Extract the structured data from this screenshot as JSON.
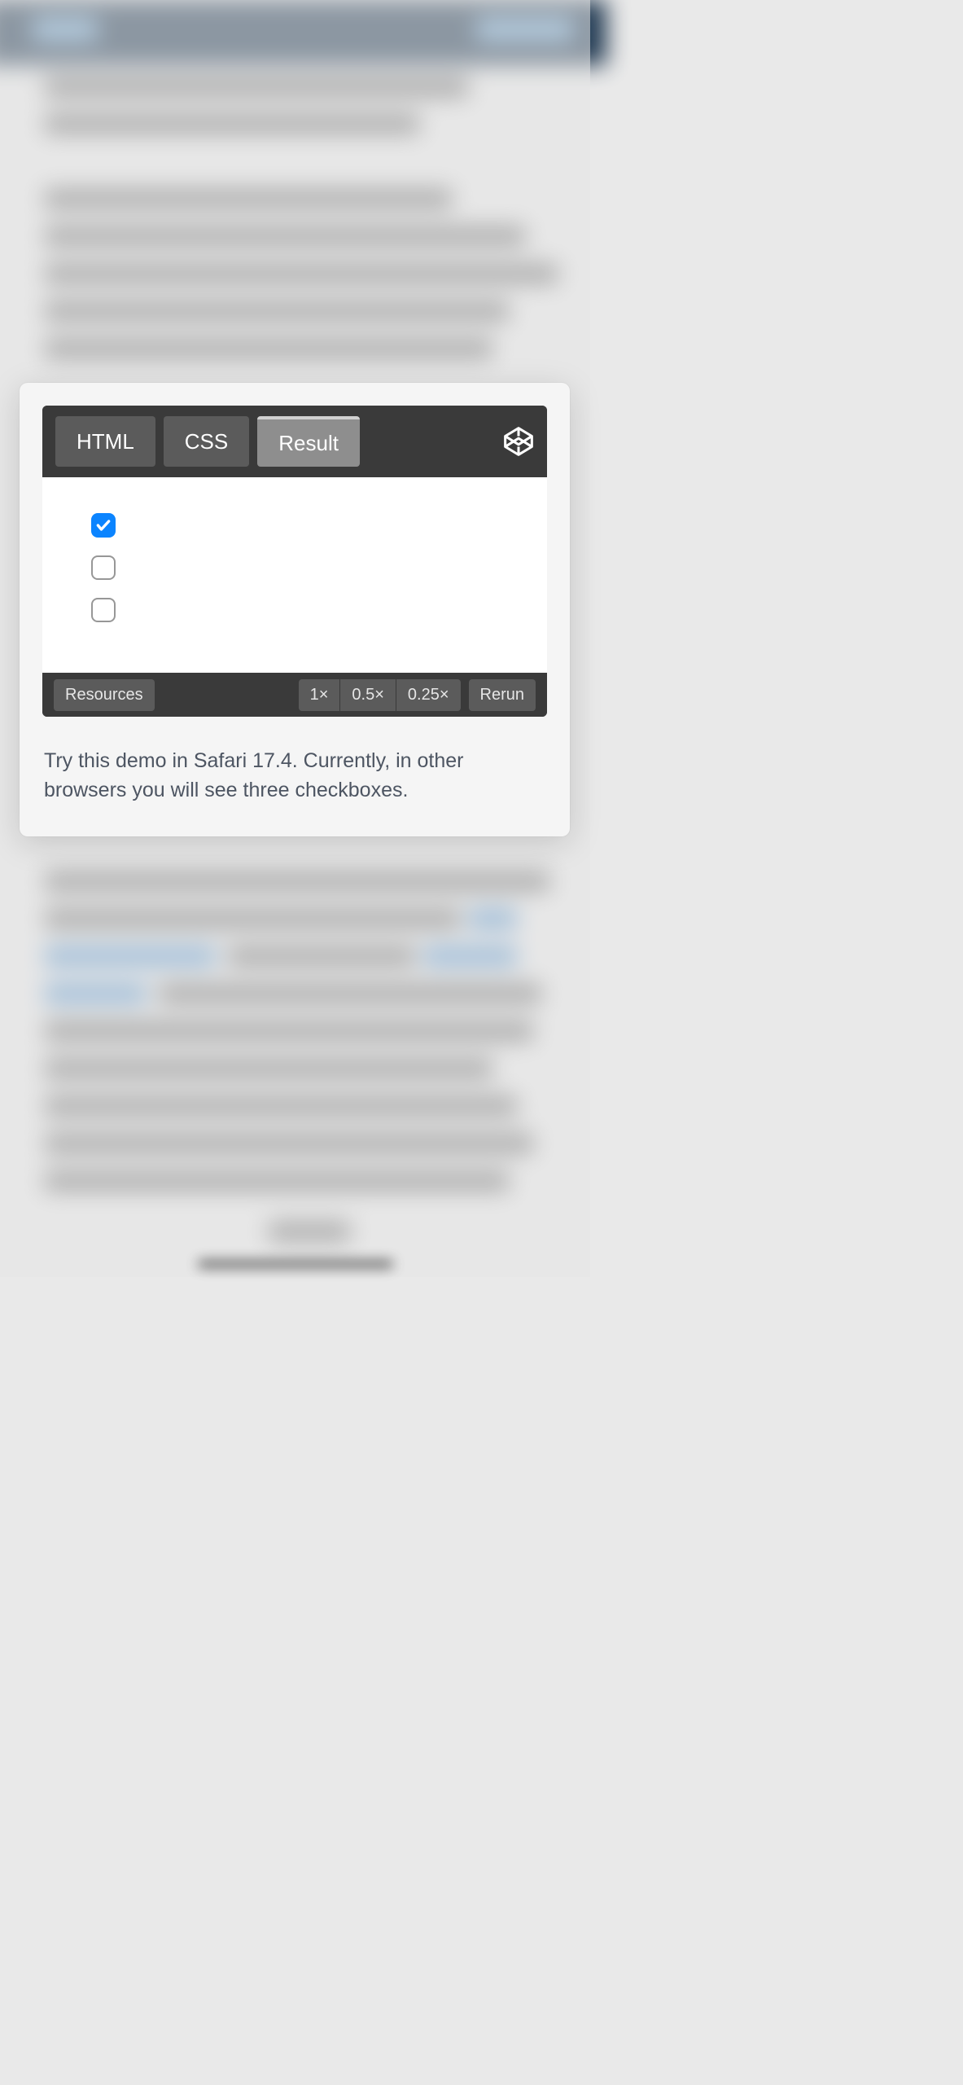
{
  "codepen": {
    "tabs": [
      {
        "label": "HTML",
        "active": false
      },
      {
        "label": "CSS",
        "active": false
      },
      {
        "label": "Result",
        "active": true
      }
    ],
    "checkboxes": [
      {
        "checked": true
      },
      {
        "checked": false
      },
      {
        "checked": false
      }
    ],
    "footer": {
      "resources": "Resources",
      "zoom": [
        "1×",
        "0.5×",
        "0.25×"
      ],
      "rerun": "Rerun"
    }
  },
  "caption": "Try this demo in Safari 17.4. Currently, in other browsers you will see three checkboxes."
}
